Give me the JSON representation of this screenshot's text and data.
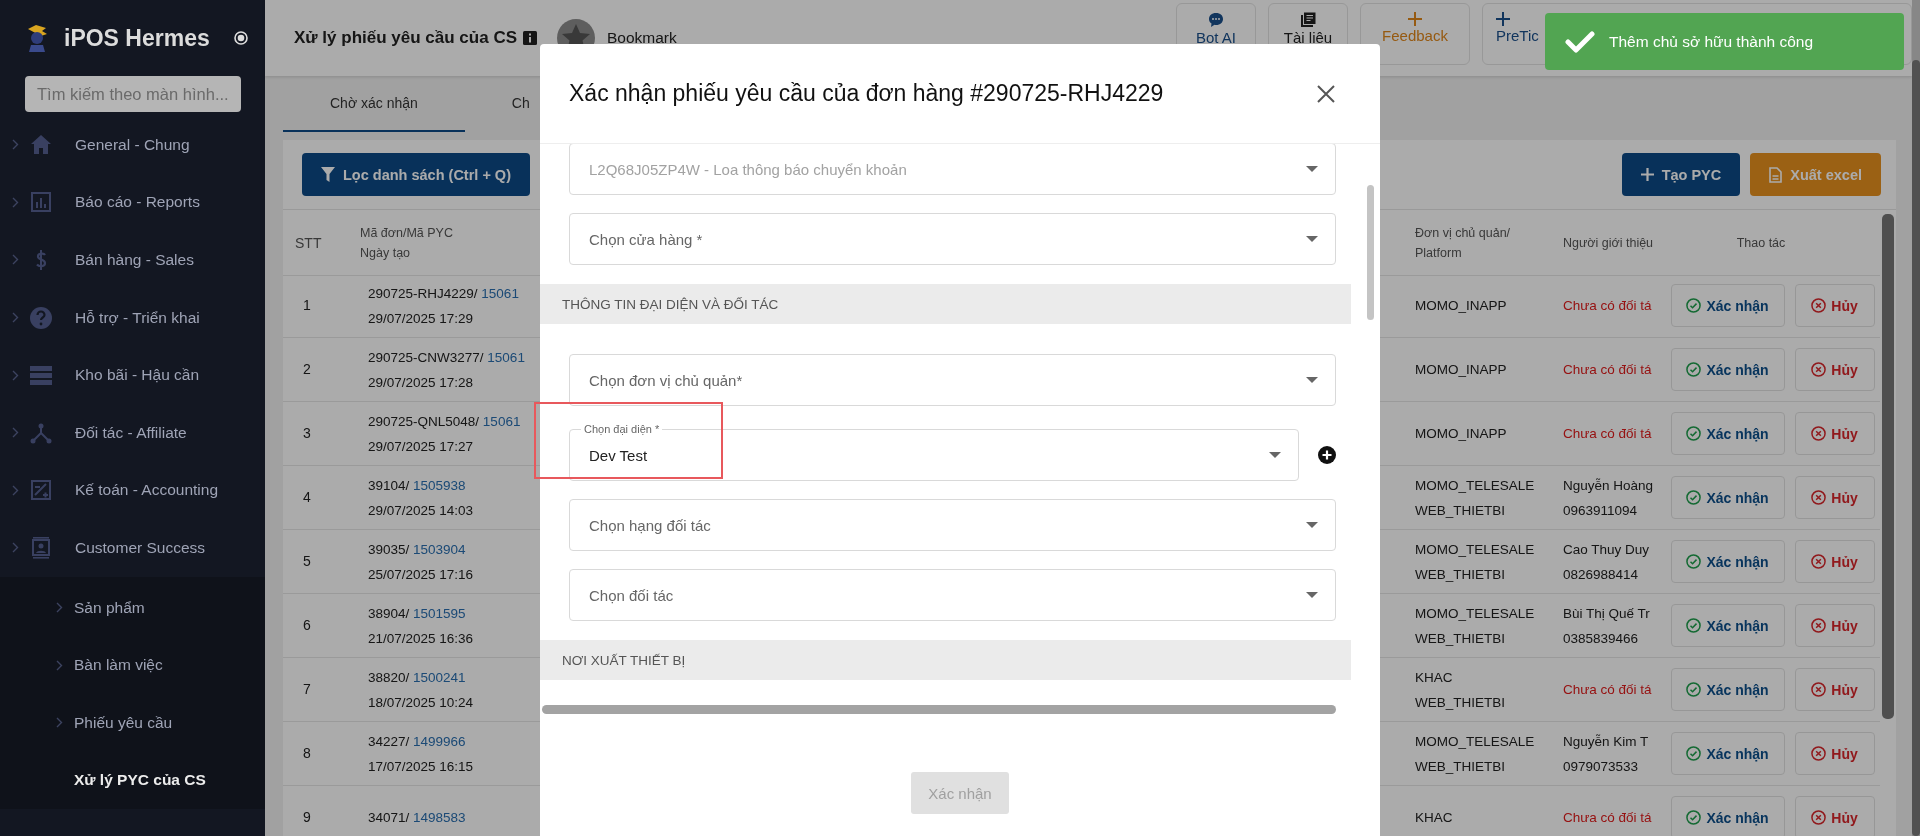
{
  "app": {
    "name": "iPOS Hermes"
  },
  "sidebar": {
    "search_placeholder": "Tìm kiếm theo màn hình...",
    "items": [
      {
        "label": "General - Chung",
        "selected": false
      },
      {
        "label": "Báo cáo - Reports",
        "selected": false
      },
      {
        "label": "Bán hàng - Sales",
        "selected": false
      },
      {
        "label": "Hỗ trợ - Triển khai",
        "selected": false
      },
      {
        "label": "Kho bãi - Hậu cần",
        "selected": false
      },
      {
        "label": "Đối tác - Affiliate",
        "selected": false
      },
      {
        "label": "Kế toán - Accounting",
        "selected": false
      },
      {
        "label": "Customer Success",
        "selected": false,
        "children": [
          {
            "label": "Sản phẩm",
            "selected": false
          },
          {
            "label": "Bàn làm việc",
            "selected": false
          },
          {
            "label": "Phiếu yêu cầu",
            "selected": false
          },
          {
            "label": "Xử lý PYC của CS",
            "selected": true
          }
        ]
      }
    ]
  },
  "header": {
    "title": "Xử lý phiếu yêu cầu của CS",
    "bookmark": "Bookmark",
    "buttons": [
      {
        "label": "Bot AI",
        "kind": "chat"
      },
      {
        "label": "Tài liệu",
        "kind": "book"
      },
      {
        "label": "Feedback",
        "kind": "feedback"
      },
      {
        "label": "PreTic",
        "kind": "create"
      }
    ]
  },
  "tabs": [
    {
      "label": "Chờ xác nhận",
      "selected": true
    },
    {
      "label": "Ch",
      "selected": false
    }
  ],
  "toolbar": {
    "filter_button": "Lọc danh sách (Ctrl + Q)",
    "create_button": "Tạo PYC",
    "export_button": "Xuất excel"
  },
  "table": {
    "columns": [
      "STT",
      "Mã đơn/Mã PYC\nNgày tạo",
      "Đơn vị chủ quản/\nPlatform",
      "Người giới thiệu",
      "Thao tác"
    ],
    "rows": [
      {
        "stt": "1",
        "order": "290725-RHJ4229/",
        "request_id": "15061",
        "created": "29/07/2025 17:29",
        "platform": [
          "MOMO_INAPP"
        ],
        "missing": true,
        "referrer": [
          "Chưa có đối tá"
        ],
        "confirm": "Xác nhận",
        "cancel": "Hủy"
      },
      {
        "stt": "2",
        "order": "290725-CNW3277/",
        "request_id": "15061",
        "created": "29/07/2025 17:28",
        "platform": [
          "MOMO_INAPP"
        ],
        "missing": true,
        "referrer": [
          "Chưa có đối tá"
        ],
        "confirm": "Xác nhận",
        "cancel": "Hủy"
      },
      {
        "stt": "3",
        "order": "290725-QNL5048/",
        "request_id": "15061",
        "created": "29/07/2025 17:27",
        "platform": [
          "MOMO_INAPP"
        ],
        "missing": true,
        "referrer": [
          "Chưa có đối tá"
        ],
        "confirm": "Xác nhận",
        "cancel": "Hủy"
      },
      {
        "stt": "4",
        "order": "39104/",
        "request_id": "1505938",
        "created": "29/07/2025 14:03",
        "platform": [
          "MOMO_TELESALE",
          "WEB_THIETBI"
        ],
        "missing": false,
        "referrer": [
          "Nguyễn Hoàng",
          "0963911094"
        ],
        "confirm": "Xác nhận",
        "cancel": "Hủy"
      },
      {
        "stt": "5",
        "order": "39035/",
        "request_id": "1503904",
        "created": "25/07/2025 17:16",
        "platform": [
          "MOMO_TELESALE",
          "WEB_THIETBI"
        ],
        "missing": false,
        "referrer": [
          "Cao Thuy Duy",
          "0826988414"
        ],
        "confirm": "Xác nhận",
        "cancel": "Hủy"
      },
      {
        "stt": "6",
        "order": "38904/",
        "request_id": "1501595",
        "created": "21/07/2025 16:36",
        "platform": [
          "MOMO_TELESALE",
          "WEB_THIETBI"
        ],
        "missing": false,
        "referrer": [
          "Bùi Thị Quế Tr",
          "0385839466"
        ],
        "confirm": "Xác nhận",
        "cancel": "Hủy"
      },
      {
        "stt": "7",
        "order": "38820/",
        "request_id": "1500241",
        "created": "18/07/2025 10:24",
        "platform": [
          "KHAC",
          "WEB_THIETBI"
        ],
        "missing": true,
        "referrer": [
          "Chưa có đối tá"
        ],
        "confirm": "Xác nhận",
        "cancel": "Hủy"
      },
      {
        "stt": "8",
        "order": "34227/",
        "request_id": "1499966",
        "created": "17/07/2025 16:15",
        "platform": [
          "MOMO_TELESALE",
          "WEB_THIETBI"
        ],
        "missing": false,
        "referrer": [
          "Nguyễn Kim T",
          "0979073533"
        ],
        "confirm": "Xác nhận",
        "cancel": "Hủy"
      },
      {
        "stt": "9",
        "order": "34071/",
        "request_id": "1498583",
        "platform": [
          "KHAC"
        ],
        "missing": true,
        "referrer": [
          "Chưa có đối tá"
        ],
        "confirm": "Xác nhận",
        "cancel": "Hủy"
      }
    ]
  },
  "modal": {
    "title": "Xác nhận phiếu yêu cầu của đơn hàng #290725-RHJ4229",
    "body": [
      {
        "kind": "select",
        "value": "L2Q68J05ZP4W - Loa thông báo chuyển khoản",
        "disabled": true
      },
      {
        "kind": "select",
        "placeholder": "Chọn cửa hàng *",
        "disabled": false
      },
      {
        "kind": "section",
        "title": "THÔNG TIN ĐẠI DIỆN VÀ ĐỐI TÁC"
      },
      {
        "kind": "select",
        "placeholder": "Chọn đơn vị chủ quản*",
        "disabled": false
      },
      {
        "kind": "select",
        "label": "Chọn đại diện *",
        "value": "Dev Test",
        "disabled": false,
        "add_button": true,
        "highlighted": true
      },
      {
        "kind": "select",
        "placeholder": "Chọn hạng đối tác",
        "disabled": false
      },
      {
        "kind": "select",
        "placeholder": "Chọn đối tác",
        "disabled": false
      },
      {
        "kind": "section",
        "title": "NƠI XUẤT THIẾT BỊ"
      }
    ],
    "submit": {
      "label": "Xác nhận",
      "disabled": true
    }
  },
  "toast": {
    "message": "Thêm chủ sở hữu thành công"
  }
}
